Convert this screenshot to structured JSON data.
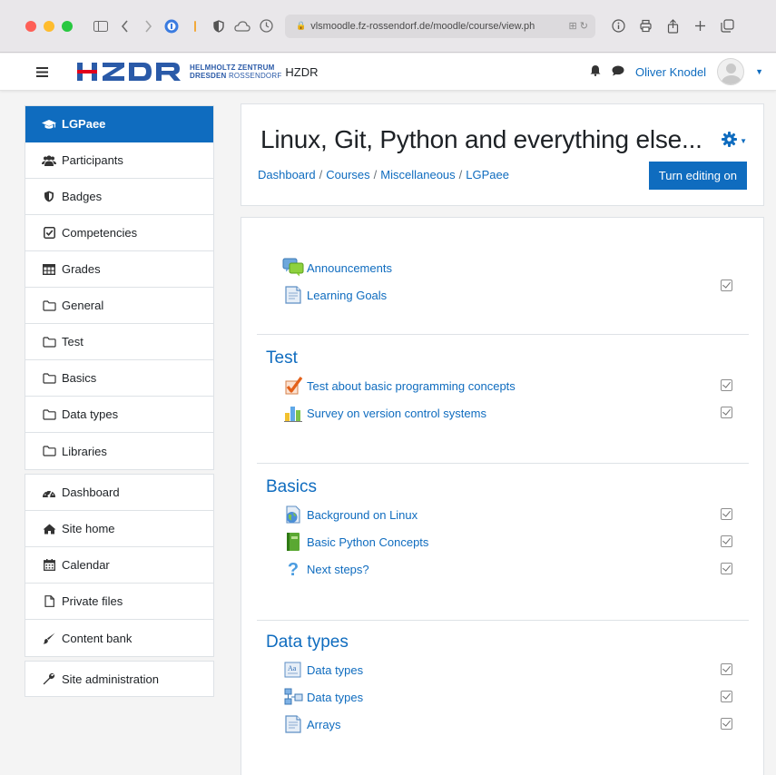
{
  "browser": {
    "url": "vlsmoodle.fz-rossendorf.de/moodle/course/view.ph",
    "url_extra": "⊞ ↻"
  },
  "navbar": {
    "logo_line1": "HELMHOLTZ ZENTRUM",
    "logo_line2_bold": "DRESDEN",
    "logo_line2_rest": " ROSSENDORF",
    "brand": "HZDR",
    "user_name": "Oliver Knodel"
  },
  "sidebar": {
    "course": [
      {
        "label": "LGPaee",
        "icon": "graduation-cap-icon"
      },
      {
        "label": "Participants",
        "icon": "users-icon"
      },
      {
        "label": "Badges",
        "icon": "shield-icon"
      },
      {
        "label": "Competencies",
        "icon": "check-square-icon"
      },
      {
        "label": "Grades",
        "icon": "table-icon"
      },
      {
        "label": "General",
        "icon": "folder-icon"
      },
      {
        "label": "Test",
        "icon": "folder-icon"
      },
      {
        "label": "Basics",
        "icon": "folder-icon"
      },
      {
        "label": "Data types",
        "icon": "folder-icon"
      },
      {
        "label": "Libraries",
        "icon": "folder-icon"
      }
    ],
    "site": [
      {
        "label": "Dashboard",
        "icon": "dashboard-icon"
      },
      {
        "label": "Site home",
        "icon": "home-icon"
      },
      {
        "label": "Calendar",
        "icon": "calendar-icon"
      },
      {
        "label": "Private files",
        "icon": "file-icon"
      },
      {
        "label": "Content bank",
        "icon": "brush-icon"
      }
    ],
    "admin": [
      {
        "label": "Site administration",
        "icon": "wrench-icon"
      }
    ]
  },
  "header": {
    "title": "Linux, Git, Python and everything else...",
    "breadcrumb": [
      "Dashboard",
      "Courses",
      "Miscellaneous",
      "LGPaee"
    ],
    "breadcrumb_sep": "/",
    "edit_button": "Turn editing on"
  },
  "sections": [
    {
      "title": "",
      "activities": [
        {
          "label": "Announcements",
          "icon": "forum-icon",
          "check": false
        },
        {
          "label": "Learning Goals",
          "icon": "page-icon",
          "check": true
        }
      ]
    },
    {
      "title": "Test",
      "activities": [
        {
          "label": "Test about basic programming concepts",
          "icon": "quiz-icon",
          "check": true
        },
        {
          "label": "Survey on version control systems",
          "icon": "survey-icon",
          "check": true
        }
      ]
    },
    {
      "title": "Basics",
      "activities": [
        {
          "label": "Background on Linux",
          "icon": "url-icon",
          "check": true
        },
        {
          "label": "Basic Python Concepts",
          "icon": "book-icon",
          "check": true
        },
        {
          "label": "Next steps?",
          "icon": "question-icon",
          "check": true
        }
      ]
    },
    {
      "title": "Data types",
      "activities": [
        {
          "label": "Data types",
          "icon": "glossary-icon",
          "check": true
        },
        {
          "label": "Data types",
          "icon": "database-icon",
          "check": true
        },
        {
          "label": "Arrays",
          "icon": "page-icon",
          "check": true
        }
      ]
    }
  ],
  "colors": {
    "accent": "#0f6cbf",
    "page_bg": "#f4f4f4",
    "logo_blue": "#2a5aa8"
  }
}
